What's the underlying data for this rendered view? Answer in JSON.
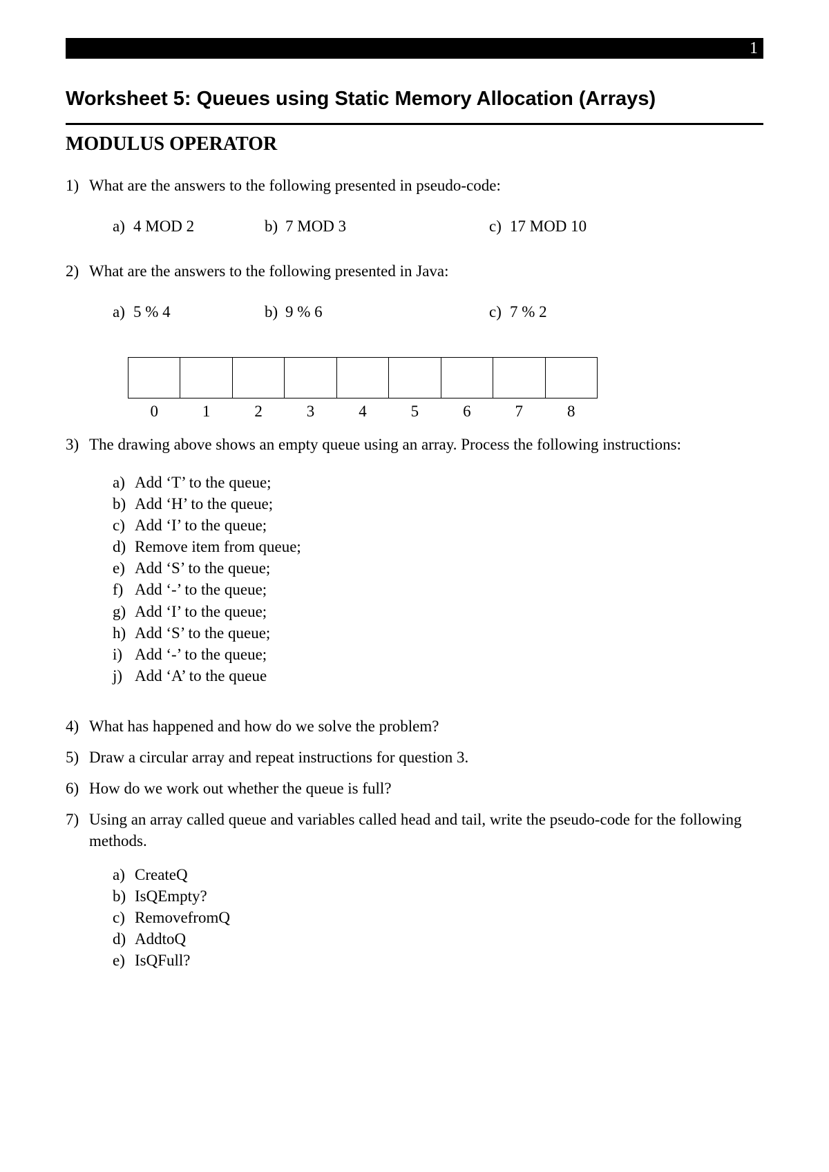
{
  "page_number": "1",
  "title": "Worksheet 5: Queues using Static Memory Allocation (Arrays)",
  "section_heading": "MODULUS OPERATOR",
  "q1": {
    "num": "1)",
    "text": "What are the answers to the following presented in pseudo-code:",
    "a_label": "a)",
    "a_text": "4 MOD 2",
    "b_label": "b)",
    "b_text": "7 MOD 3",
    "c_label": "c)",
    "c_text": "17 MOD 10"
  },
  "q2": {
    "num": "2)",
    "text": "What are the answers to the following presented in Java:",
    "a_label": "a)",
    "a_text": "5 % 4",
    "b_label": "b)",
    "b_text": "9 % 6",
    "c_label": "c)",
    "c_text": "7 % 2"
  },
  "array_indices": [
    "0",
    "1",
    "2",
    "3",
    "4",
    "5",
    "6",
    "7",
    "8"
  ],
  "q3": {
    "num": "3)",
    "text": "The drawing above shows an empty queue using an array. Process the following instructions:",
    "items": [
      {
        "l": "a)",
        "t": "Add ‘T’ to the queue;"
      },
      {
        "l": "b)",
        "t": "Add ‘H’ to the queue;"
      },
      {
        "l": "c)",
        "t": "Add ‘I’ to the queue;"
      },
      {
        "l": "d)",
        "t": "Remove item from queue;"
      },
      {
        "l": "e)",
        "t": "Add ‘S’ to the queue;"
      },
      {
        "l": "f)",
        "t": "Add ‘-’ to the queue;"
      },
      {
        "l": "g)",
        "t": "Add ‘I’ to the queue;"
      },
      {
        "l": "h)",
        "t": "Add ‘S’ to the queue;"
      },
      {
        "l": "i)",
        "t": "Add ‘-’ to the queue;"
      },
      {
        "l": "j)",
        "t": "Add ‘A’ to the queue"
      }
    ]
  },
  "q4": {
    "num": "4)",
    "text": "What has happened and how do we solve the problem?"
  },
  "q5": {
    "num": "5)",
    "text": "Draw a circular array and repeat instructions for question 3."
  },
  "q6": {
    "num": "6)",
    "text": "How do we work out whether the queue is full?"
  },
  "q7": {
    "num": "7)",
    "text": "Using an array called queue and variables called head and tail, write the pseudo-code for the following methods.",
    "items": [
      {
        "l": "a)",
        "t": "CreateQ"
      },
      {
        "l": "b)",
        "t": "IsQEmpty?"
      },
      {
        "l": "c)",
        "t": "RemovefromQ"
      },
      {
        "l": "d)",
        "t": "AddtoQ"
      },
      {
        "l": "e)",
        "t": "IsQFull?"
      }
    ]
  }
}
